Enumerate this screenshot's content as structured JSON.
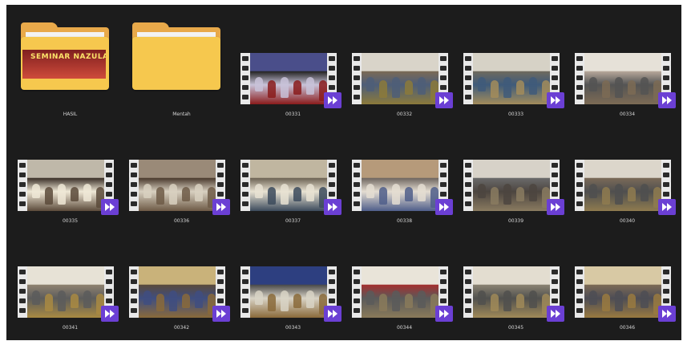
{
  "items": [
    {
      "type": "folder",
      "name": "HASIL",
      "poster_text": "SEMINAR NAZULA"
    },
    {
      "type": "folder",
      "name": "Mentah"
    },
    {
      "type": "video",
      "name": "00331",
      "scene": [
        "#232323",
        "#4a4e8a",
        "#c8c2d8",
        "#8a1b1b"
      ]
    },
    {
      "type": "video",
      "name": "00332",
      "scene": [
        "#7a6a56",
        "#d9d4c9",
        "#4e5e78",
        "#8c7a3a"
      ]
    },
    {
      "type": "video",
      "name": "00333",
      "scene": [
        "#6e6a5e",
        "#d6d2c6",
        "#3f5b7a",
        "#a38c5b"
      ]
    },
    {
      "type": "video",
      "name": "00334",
      "scene": [
        "#b6a79a",
        "#e6e1d8",
        "#545454",
        "#7d6b55"
      ]
    },
    {
      "type": "video",
      "name": "00335",
      "scene": [
        "#3a2f27",
        "#bfb8a9",
        "#efe8d6",
        "#5b4a3a"
      ]
    },
    {
      "type": "video",
      "name": "00336",
      "scene": [
        "#4a3a2d",
        "#9a8a78",
        "#d8d0c0",
        "#6d5a46"
      ]
    },
    {
      "type": "video",
      "name": "00337",
      "scene": [
        "#6d6354",
        "#c0b6a0",
        "#e8e2d2",
        "#3b4a5c"
      ]
    },
    {
      "type": "video",
      "name": "00338",
      "scene": [
        "#6f6660",
        "#b69a7a",
        "#e4ddd1",
        "#4f5e8a"
      ]
    },
    {
      "type": "video",
      "name": "00339",
      "scene": [
        "#6a6a6a",
        "#d7d2c8",
        "#4c4540",
        "#8a7b60"
      ]
    },
    {
      "type": "video",
      "name": "00340",
      "scene": [
        "#7a6a58",
        "#dcd6cb",
        "#4f4f4f",
        "#8f7b4f"
      ]
    },
    {
      "type": "video",
      "name": "00341",
      "scene": [
        "#8e8270",
        "#e7e2d6",
        "#5c5c5c",
        "#a98a42"
      ]
    },
    {
      "type": "video",
      "name": "00342",
      "scene": [
        "#5a4a3c",
        "#c9b27a",
        "#3f4e80",
        "#8a6a3a"
      ]
    },
    {
      "type": "video",
      "name": "00343",
      "scene": [
        "#4a4a4a",
        "#2d3f80",
        "#d8d3c6",
        "#8a6a3a"
      ]
    },
    {
      "type": "video",
      "name": "00344",
      "scene": [
        "#a33030",
        "#e9e4d9",
        "#5a5a5a",
        "#8a7a5a"
      ]
    },
    {
      "type": "video",
      "name": "00345",
      "scene": [
        "#8a8272",
        "#e3ddd0",
        "#50504e",
        "#a08a58"
      ]
    },
    {
      "type": "video",
      "name": "00346",
      "scene": [
        "#7c6a55",
        "#d8c9a4",
        "#4d4d55",
        "#9a7a40"
      ]
    }
  ]
}
